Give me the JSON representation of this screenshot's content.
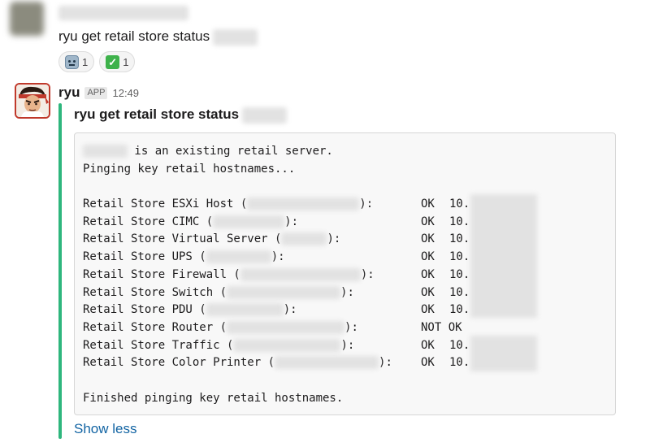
{
  "message1": {
    "text": "ryu get retail store status",
    "reactions": [
      {
        "icon": "robot-icon",
        "count": "1"
      },
      {
        "icon": "check-icon",
        "count": "1"
      }
    ]
  },
  "message2": {
    "sender": "ryu",
    "badge": "APP",
    "time": "12:49",
    "attachment": {
      "title": "ryu get retail store status",
      "color": "#2eb67d",
      "lines": {
        "intro1": " is an existing retail server.",
        "intro2": "Pinging key retail hostnames...",
        "esxi": {
          "label": "Retail Store ESXi Host (",
          "close": "):",
          "status": "OK",
          "ip": "10."
        },
        "cimc": {
          "label": "Retail Store CIMC (",
          "close": "):",
          "status": "OK",
          "ip": "10."
        },
        "vserver": {
          "label": "Retail Store Virtual Server (",
          "close": "):",
          "status": "OK",
          "ip": "10."
        },
        "ups": {
          "label": "Retail Store UPS (",
          "close": "):",
          "status": "OK",
          "ip": "10."
        },
        "firewall": {
          "label": "Retail Store Firewall (",
          "close": "):",
          "status": "OK",
          "ip": "10."
        },
        "switch": {
          "label": "Retail Store Switch (",
          "close": "):",
          "status": "OK",
          "ip": "10."
        },
        "pdu": {
          "label": "Retail Store PDU (",
          "close": "):",
          "status": "OK",
          "ip": "10."
        },
        "router": {
          "label": "Retail Store Router (",
          "close": "):",
          "status": "NOT OK",
          "ip": ""
        },
        "traffic": {
          "label": "Retail Store Traffic (",
          "close": "):",
          "status": "OK",
          "ip": "10."
        },
        "printer": {
          "label": "Retail Store Color Printer (",
          "close": "):",
          "status": "OK",
          "ip": "10."
        },
        "finish": "Finished pinging key retail hostnames."
      }
    },
    "show_less": "Show less"
  }
}
